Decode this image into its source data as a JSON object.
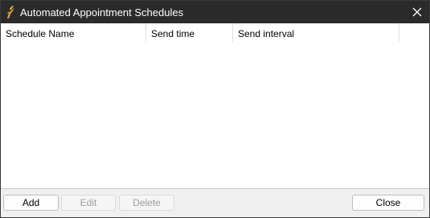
{
  "window": {
    "title": "Automated Appointment Schedules",
    "app_icon": "app-logo-icon",
    "close_icon": "close-icon"
  },
  "table": {
    "columns": [
      "Schedule Name",
      "Send time",
      "Send interval"
    ],
    "rows": []
  },
  "buttons": {
    "add": "Add",
    "edit": "Edit",
    "delete": "Delete",
    "close": "Close"
  },
  "colors": {
    "titlebar": "#2b2b2b",
    "disabled_text": "#9e9e9e"
  }
}
